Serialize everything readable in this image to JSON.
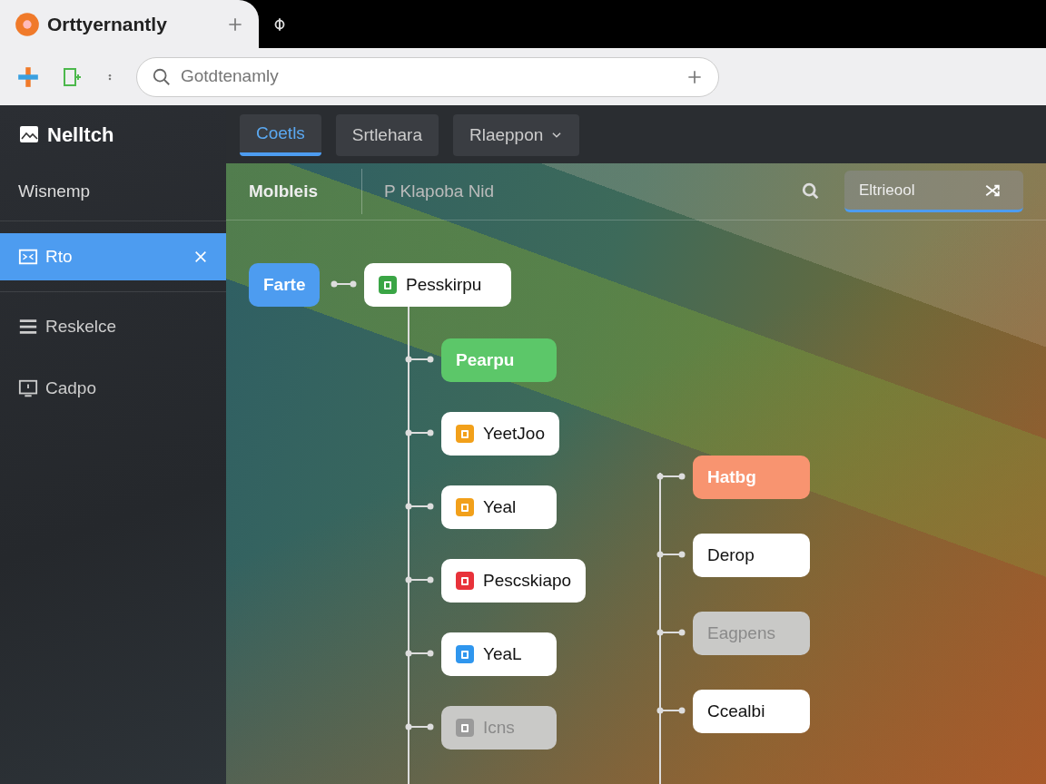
{
  "browser": {
    "tab_title": "Orttyernantly",
    "address_placeholder": "Gotdtenamly"
  },
  "sidebar": {
    "brand": "Nelltch",
    "heading": "Wisnemp",
    "items": [
      {
        "label": "Rto",
        "kind": "image",
        "selected": true
      },
      {
        "label": "Reskelce",
        "kind": "menu",
        "selected": false
      },
      {
        "label": "Cadpo",
        "kind": "screen",
        "selected": false
      }
    ]
  },
  "tabs": [
    {
      "label": "Coetls",
      "selected": true,
      "dropdown": false
    },
    {
      "label": "Srtlehara",
      "selected": false,
      "dropdown": false
    },
    {
      "label": "Rlaeppon",
      "selected": false,
      "dropdown": true
    }
  ],
  "toolbar": {
    "title": "Molbleis",
    "subtitle": "P Klapoba Nid",
    "search_value": "Eltrieool"
  },
  "diagram": {
    "root": {
      "label": "Farte",
      "color": "#4d9cf0"
    },
    "hub": {
      "label": "Pesskirpu",
      "icon": {
        "color": "#3aa545"
      }
    },
    "column_1": [
      {
        "label": "Pearpu",
        "color": "#5cc769",
        "disabled": false
      },
      {
        "label": "YeetJoo",
        "icon": {
          "color": "#f2a01a"
        },
        "disabled": false
      },
      {
        "label": "Yeal",
        "icon": {
          "color": "#f2a01a"
        },
        "disabled": false
      },
      {
        "label": "Pescskiapo",
        "icon": {
          "color": "#e8323a"
        },
        "disabled": false
      },
      {
        "label": "YeaL",
        "icon": {
          "color": "#2f96ee"
        },
        "disabled": false
      },
      {
        "label": "Icns",
        "icon": {
          "color": "#9a9a9a"
        },
        "disabled": true
      }
    ],
    "column_2": [
      {
        "label": "Hatbg",
        "color": "#f89470",
        "disabled": false
      },
      {
        "label": "Derop",
        "disabled": false
      },
      {
        "label": "Eagpens",
        "disabled": true
      },
      {
        "label": "Ccealbi",
        "disabled": false
      }
    ]
  }
}
